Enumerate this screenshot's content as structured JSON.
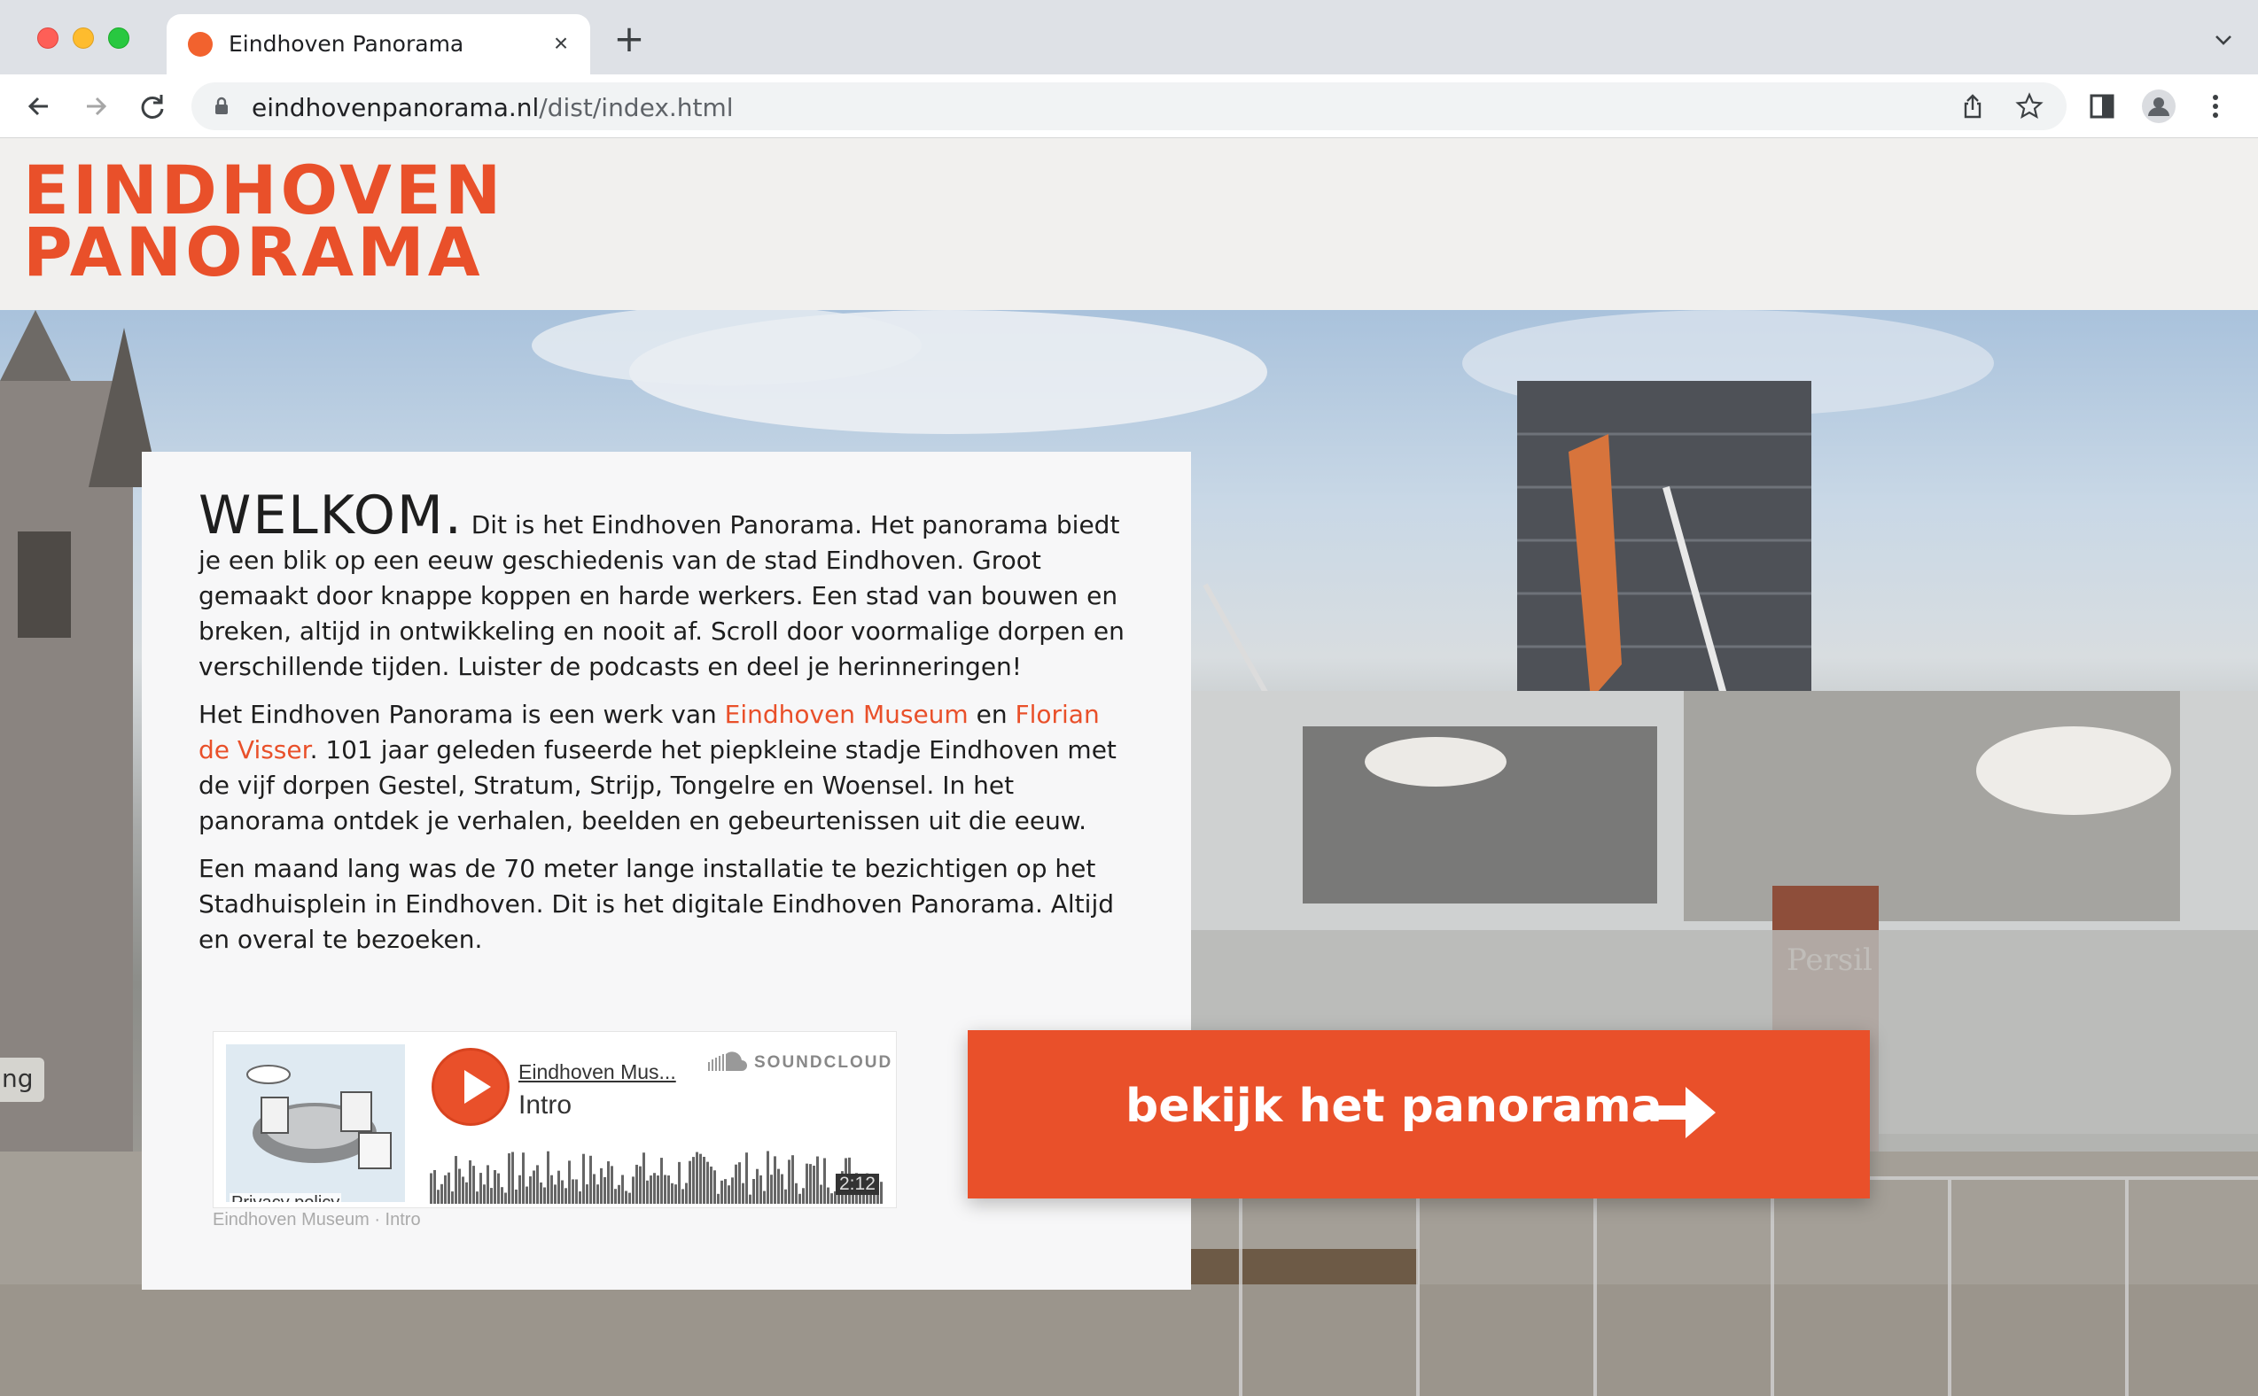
{
  "browser": {
    "tab_title": "Eindhoven Panorama",
    "new_tab_label": "+",
    "close_tab_label": "×",
    "url_domain": "eindhovenpanorama.nl",
    "url_path": "/dist/index.html"
  },
  "header": {
    "logo_line1": "EINDHOVEN",
    "logo_line2": "PANORAMA"
  },
  "side_tab": {
    "label": "ng"
  },
  "welcome": {
    "heading": "WELKOM.",
    "intro": "Dit is het Eindhoven Panorama. Het panorama biedt je een blik op een eeuw geschiedenis van de stad Eindhoven. Groot gemaakt door knappe koppen en harde werkers. Een stad van bouwen en breken, altijd in ontwikkeling en nooit af. Scroll door voormalige dorpen en verschillende tijden. Luister de podcasts en deel je herinneringen!",
    "p2_before": "Het Eindhoven Panorama is een werk van ",
    "link_museum": "Eindhoven Museum",
    "p2_mid": " en ",
    "link_artist": "Florian de Visser",
    "p2_after": ". 101 jaar geleden fuseerde het piepkleine stadje Eindhoven met de vijf dorpen Gestel, Stratum, Strijp, Tongelre en Woensel. In het panorama ontdek je verhalen, beelden en gebeurtenissen uit die eeuw.",
    "p3": "Een maand lang was de 70 meter lange installatie te bezichtigen op het Stadhuisplein in Eindhoven. Dit is het digitale Eindhoven Panorama. Altijd en overal te bezoeken."
  },
  "soundcloud": {
    "user": "Eindhoven Mus...",
    "track": "Intro",
    "brand": "SOUNDCLOUD",
    "duration": "2:12",
    "privacy": "Privacy policy",
    "caption": "Eindhoven Museum · Intro"
  },
  "cta": {
    "label": "bekijk het panorama"
  },
  "colors": {
    "accent": "#e9502a",
    "header_bg": "#f1f0ee",
    "card_bg": "#f7f7f8"
  }
}
